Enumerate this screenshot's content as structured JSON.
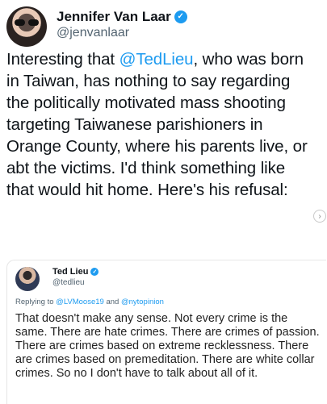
{
  "author": {
    "display_name": "Jennifer Van Laar",
    "handle": "@jenvanlaar"
  },
  "tweet": {
    "mention": "@TedLieu",
    "text_before": "Interesting that ",
    "text_after": ", who was born in Taiwan, has nothing to say regarding the politically motivated mass shooting targeting Taiwanese parishioners in Orange County, where his parents live, or abt the victims. I'd think something like that would hit home. Here's his refusal:"
  },
  "quoted": {
    "display_name": "Ted Lieu",
    "handle": "@tedlieu",
    "replying_prefix": "Replying to ",
    "replying_user1": "@LVMoose19",
    "replying_and": " and ",
    "replying_user2": "@nytopinion",
    "text": "That doesn't make any sense. Not every crime is the same. There are hate crimes. There are crimes of passion. There are crimes based on extreme recklessness. There are crimes based on premeditation. There are white collar crimes. So no I don't have to talk about all of it."
  },
  "icons": {
    "verified": "verified-check-icon",
    "scroll": "chevron-right-icon"
  },
  "colors": {
    "accent": "#1d9bf0",
    "text": "#0f1419",
    "muted": "#536471"
  }
}
